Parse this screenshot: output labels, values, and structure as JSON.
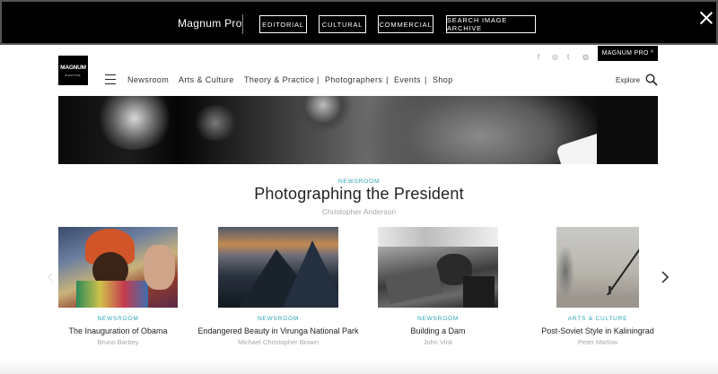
{
  "probar": {
    "title": "Magnum Pro",
    "buttons": [
      "EDITORIAL",
      "CULTURAL",
      "COMMERCIAL",
      "SEARCH IMAGE ARCHIVE"
    ]
  },
  "header": {
    "logo_text": "MAGNUM",
    "logo_sub": "PHOTOS",
    "social": [
      "f",
      "◎",
      "t",
      "◍"
    ],
    "pro_tab": "MAGNUM PRO ^",
    "nav": [
      "Newsroom",
      "Arts & Culture",
      "Theory & Practice",
      "Photographers",
      "Events",
      "Shop"
    ],
    "nav_separator": "|",
    "explore": "Explore"
  },
  "featured": {
    "category": "NEWSROOM",
    "title": "Photographing the President",
    "author": "Christopher Anderson"
  },
  "cards": [
    {
      "category": "NEWSROOM",
      "title": "The Inauguration of Obama",
      "author": "Bruno Barbey"
    },
    {
      "category": "NEWSROOM",
      "title": "Endangered Beauty in Virunga National Park",
      "author": "Michael Christopher Brown"
    },
    {
      "category": "NEWSROOM",
      "title": "Building a Dam",
      "author": "John Vink"
    },
    {
      "category": "ARTS & CULTURE",
      "title": "Post-Soviet Style in Kaliningrad",
      "author": "Peter Marlow"
    }
  ],
  "colors": {
    "accent": "#27a5b3",
    "bar": "#000000",
    "muted": "#a8a8a8"
  }
}
